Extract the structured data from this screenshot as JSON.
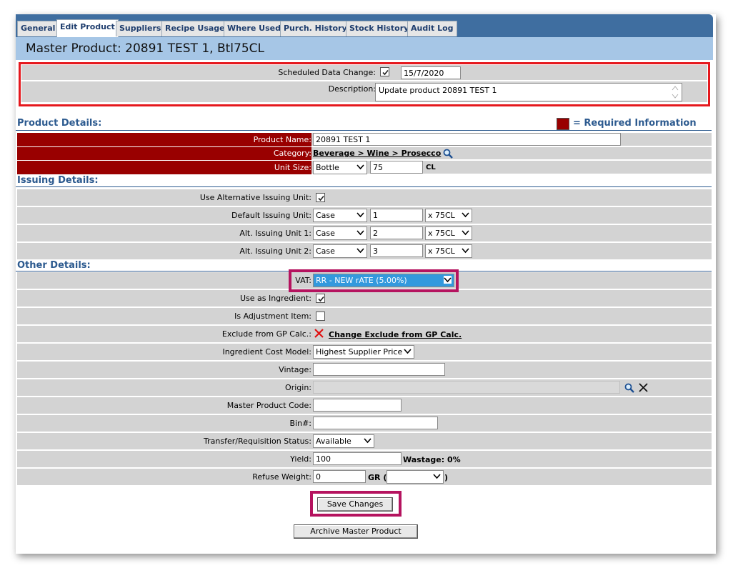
{
  "tabs": [
    "General",
    "Edit Product",
    "Suppliers",
    "Recipe Usage",
    "Where Used",
    "Purch. History",
    "Stock History",
    "Audit Log"
  ],
  "page_title": "Master Product: 20891 TEST 1, Btl75CL",
  "scheduled": {
    "label": "Scheduled Data Change:",
    "checked": true,
    "date": "15/7/2020",
    "description_label": "Description:",
    "description": "Update product 20891 TEST 1"
  },
  "product_details": {
    "title": "Product Details:",
    "required_legend": "= Required Information",
    "required_color": "#990000",
    "product_name_label": "Product Name:",
    "product_name": "20891 TEST 1",
    "category_label": "Category:",
    "category": "Beverage > Wine > Prosecco",
    "unit_size_label": "Unit Size:",
    "unit": "Bottle",
    "unit_qty": "75",
    "unit_measure": "CL"
  },
  "issuing": {
    "title": "Issuing Details:",
    "alt_unit_label": "Use Alternative Issuing Unit:",
    "alt_unit_checked": true,
    "rows": [
      {
        "label": "Default Issuing Unit:",
        "unit": "Case",
        "qty": "1",
        "size": "x 75CL"
      },
      {
        "label": "Alt. Issuing Unit 1:",
        "unit": "Case",
        "qty": "2",
        "size": "x 75CL"
      },
      {
        "label": "Alt. Issuing Unit 2:",
        "unit": "Case",
        "qty": "3",
        "size": "x 75CL"
      }
    ]
  },
  "other": {
    "title": "Other Details:",
    "vat_label": "VAT:",
    "vat": "RR - NEW rATE (5.00%)",
    "ingredient_label": "Use as Ingredient:",
    "adjustment_label": "Is Adjustment Item:",
    "exclude_label": "Exclude from GP Calc.:",
    "exclude_link": "Change Exclude from GP Calc.",
    "cost_model_label": "Ingredient Cost Model:",
    "cost_model": "Highest Supplier Price",
    "vintage_label": "Vintage:",
    "vintage": "",
    "origin_label": "Origin:",
    "origin": "",
    "code_label": "Master Product Code:",
    "code": "",
    "bin_label": "Bin#:",
    "bin": "",
    "transfer_label": "Transfer/Requisition Status:",
    "transfer": "Available",
    "yield_label": "Yield:",
    "yield": "100",
    "wastage": "Wastage: 0%",
    "refuse_label": "Refuse Weight:",
    "refuse": "0",
    "refuse_unit": "GR (",
    "refuse_close": ")"
  },
  "buttons": {
    "save": "Save Changes",
    "archive": "Archive Master Product"
  },
  "colors": {
    "tabbar": "#3f6ea0",
    "title_bg": "#a6c6e6",
    "highlight_red": "#e5181d",
    "highlight_magenta": "#b5135f",
    "vat_selected": "#3399dd"
  }
}
